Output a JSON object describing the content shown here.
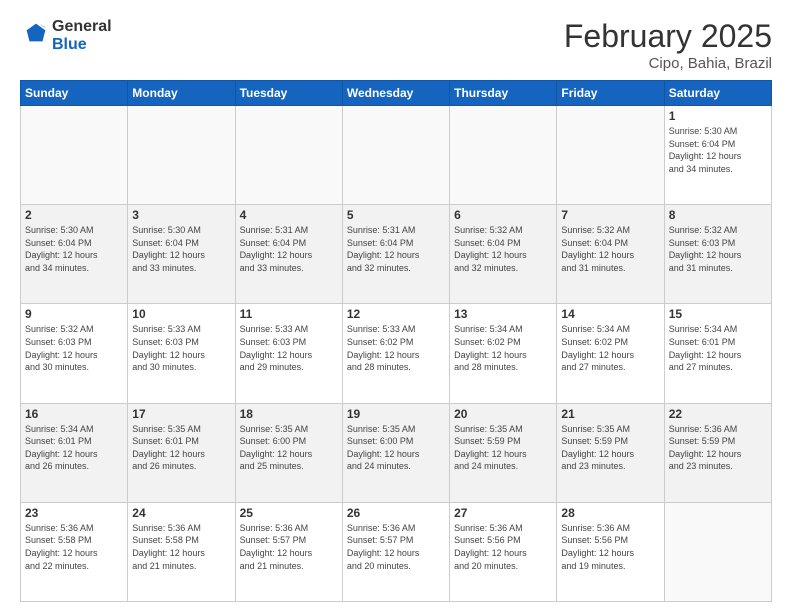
{
  "logo": {
    "general": "General",
    "blue": "Blue"
  },
  "header": {
    "month": "February 2025",
    "location": "Cipo, Bahia, Brazil"
  },
  "weekdays": [
    "Sunday",
    "Monday",
    "Tuesday",
    "Wednesday",
    "Thursday",
    "Friday",
    "Saturday"
  ],
  "weeks": [
    [
      {
        "day": "",
        "info": ""
      },
      {
        "day": "",
        "info": ""
      },
      {
        "day": "",
        "info": ""
      },
      {
        "day": "",
        "info": ""
      },
      {
        "day": "",
        "info": ""
      },
      {
        "day": "",
        "info": ""
      },
      {
        "day": "1",
        "info": "Sunrise: 5:30 AM\nSunset: 6:04 PM\nDaylight: 12 hours\nand 34 minutes."
      }
    ],
    [
      {
        "day": "2",
        "info": "Sunrise: 5:30 AM\nSunset: 6:04 PM\nDaylight: 12 hours\nand 34 minutes."
      },
      {
        "day": "3",
        "info": "Sunrise: 5:30 AM\nSunset: 6:04 PM\nDaylight: 12 hours\nand 33 minutes."
      },
      {
        "day": "4",
        "info": "Sunrise: 5:31 AM\nSunset: 6:04 PM\nDaylight: 12 hours\nand 33 minutes."
      },
      {
        "day": "5",
        "info": "Sunrise: 5:31 AM\nSunset: 6:04 PM\nDaylight: 12 hours\nand 32 minutes."
      },
      {
        "day": "6",
        "info": "Sunrise: 5:32 AM\nSunset: 6:04 PM\nDaylight: 12 hours\nand 32 minutes."
      },
      {
        "day": "7",
        "info": "Sunrise: 5:32 AM\nSunset: 6:04 PM\nDaylight: 12 hours\nand 31 minutes."
      },
      {
        "day": "8",
        "info": "Sunrise: 5:32 AM\nSunset: 6:03 PM\nDaylight: 12 hours\nand 31 minutes."
      }
    ],
    [
      {
        "day": "9",
        "info": "Sunrise: 5:32 AM\nSunset: 6:03 PM\nDaylight: 12 hours\nand 30 minutes."
      },
      {
        "day": "10",
        "info": "Sunrise: 5:33 AM\nSunset: 6:03 PM\nDaylight: 12 hours\nand 30 minutes."
      },
      {
        "day": "11",
        "info": "Sunrise: 5:33 AM\nSunset: 6:03 PM\nDaylight: 12 hours\nand 29 minutes."
      },
      {
        "day": "12",
        "info": "Sunrise: 5:33 AM\nSunset: 6:02 PM\nDaylight: 12 hours\nand 28 minutes."
      },
      {
        "day": "13",
        "info": "Sunrise: 5:34 AM\nSunset: 6:02 PM\nDaylight: 12 hours\nand 28 minutes."
      },
      {
        "day": "14",
        "info": "Sunrise: 5:34 AM\nSunset: 6:02 PM\nDaylight: 12 hours\nand 27 minutes."
      },
      {
        "day": "15",
        "info": "Sunrise: 5:34 AM\nSunset: 6:01 PM\nDaylight: 12 hours\nand 27 minutes."
      }
    ],
    [
      {
        "day": "16",
        "info": "Sunrise: 5:34 AM\nSunset: 6:01 PM\nDaylight: 12 hours\nand 26 minutes."
      },
      {
        "day": "17",
        "info": "Sunrise: 5:35 AM\nSunset: 6:01 PM\nDaylight: 12 hours\nand 26 minutes."
      },
      {
        "day": "18",
        "info": "Sunrise: 5:35 AM\nSunset: 6:00 PM\nDaylight: 12 hours\nand 25 minutes."
      },
      {
        "day": "19",
        "info": "Sunrise: 5:35 AM\nSunset: 6:00 PM\nDaylight: 12 hours\nand 24 minutes."
      },
      {
        "day": "20",
        "info": "Sunrise: 5:35 AM\nSunset: 5:59 PM\nDaylight: 12 hours\nand 24 minutes."
      },
      {
        "day": "21",
        "info": "Sunrise: 5:35 AM\nSunset: 5:59 PM\nDaylight: 12 hours\nand 23 minutes."
      },
      {
        "day": "22",
        "info": "Sunrise: 5:36 AM\nSunset: 5:59 PM\nDaylight: 12 hours\nand 23 minutes."
      }
    ],
    [
      {
        "day": "23",
        "info": "Sunrise: 5:36 AM\nSunset: 5:58 PM\nDaylight: 12 hours\nand 22 minutes."
      },
      {
        "day": "24",
        "info": "Sunrise: 5:36 AM\nSunset: 5:58 PM\nDaylight: 12 hours\nand 21 minutes."
      },
      {
        "day": "25",
        "info": "Sunrise: 5:36 AM\nSunset: 5:57 PM\nDaylight: 12 hours\nand 21 minutes."
      },
      {
        "day": "26",
        "info": "Sunrise: 5:36 AM\nSunset: 5:57 PM\nDaylight: 12 hours\nand 20 minutes."
      },
      {
        "day": "27",
        "info": "Sunrise: 5:36 AM\nSunset: 5:56 PM\nDaylight: 12 hours\nand 20 minutes."
      },
      {
        "day": "28",
        "info": "Sunrise: 5:36 AM\nSunset: 5:56 PM\nDaylight: 12 hours\nand 19 minutes."
      },
      {
        "day": "",
        "info": ""
      }
    ]
  ]
}
